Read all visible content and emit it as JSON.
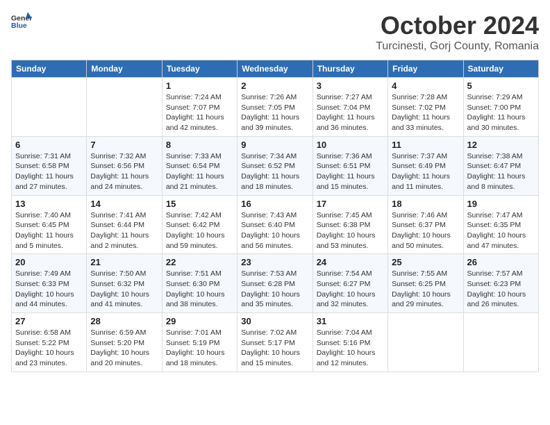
{
  "header": {
    "logo_general": "General",
    "logo_blue": "Blue",
    "month": "October 2024",
    "location": "Turcinesti, Gorj County, Romania"
  },
  "weekdays": [
    "Sunday",
    "Monday",
    "Tuesday",
    "Wednesday",
    "Thursday",
    "Friday",
    "Saturday"
  ],
  "weeks": [
    [
      {
        "day": "",
        "sunrise": "",
        "sunset": "",
        "daylight": ""
      },
      {
        "day": "",
        "sunrise": "",
        "sunset": "",
        "daylight": ""
      },
      {
        "day": "1",
        "sunrise": "Sunrise: 7:24 AM",
        "sunset": "Sunset: 7:07 PM",
        "daylight": "Daylight: 11 hours and 42 minutes."
      },
      {
        "day": "2",
        "sunrise": "Sunrise: 7:26 AM",
        "sunset": "Sunset: 7:05 PM",
        "daylight": "Daylight: 11 hours and 39 minutes."
      },
      {
        "day": "3",
        "sunrise": "Sunrise: 7:27 AM",
        "sunset": "Sunset: 7:04 PM",
        "daylight": "Daylight: 11 hours and 36 minutes."
      },
      {
        "day": "4",
        "sunrise": "Sunrise: 7:28 AM",
        "sunset": "Sunset: 7:02 PM",
        "daylight": "Daylight: 11 hours and 33 minutes."
      },
      {
        "day": "5",
        "sunrise": "Sunrise: 7:29 AM",
        "sunset": "Sunset: 7:00 PM",
        "daylight": "Daylight: 11 hours and 30 minutes."
      }
    ],
    [
      {
        "day": "6",
        "sunrise": "Sunrise: 7:31 AM",
        "sunset": "Sunset: 6:58 PM",
        "daylight": "Daylight: 11 hours and 27 minutes."
      },
      {
        "day": "7",
        "sunrise": "Sunrise: 7:32 AM",
        "sunset": "Sunset: 6:56 PM",
        "daylight": "Daylight: 11 hours and 24 minutes."
      },
      {
        "day": "8",
        "sunrise": "Sunrise: 7:33 AM",
        "sunset": "Sunset: 6:54 PM",
        "daylight": "Daylight: 11 hours and 21 minutes."
      },
      {
        "day": "9",
        "sunrise": "Sunrise: 7:34 AM",
        "sunset": "Sunset: 6:52 PM",
        "daylight": "Daylight: 11 hours and 18 minutes."
      },
      {
        "day": "10",
        "sunrise": "Sunrise: 7:36 AM",
        "sunset": "Sunset: 6:51 PM",
        "daylight": "Daylight: 11 hours and 15 minutes."
      },
      {
        "day": "11",
        "sunrise": "Sunrise: 7:37 AM",
        "sunset": "Sunset: 6:49 PM",
        "daylight": "Daylight: 11 hours and 11 minutes."
      },
      {
        "day": "12",
        "sunrise": "Sunrise: 7:38 AM",
        "sunset": "Sunset: 6:47 PM",
        "daylight": "Daylight: 11 hours and 8 minutes."
      }
    ],
    [
      {
        "day": "13",
        "sunrise": "Sunrise: 7:40 AM",
        "sunset": "Sunset: 6:45 PM",
        "daylight": "Daylight: 11 hours and 5 minutes."
      },
      {
        "day": "14",
        "sunrise": "Sunrise: 7:41 AM",
        "sunset": "Sunset: 6:44 PM",
        "daylight": "Daylight: 11 hours and 2 minutes."
      },
      {
        "day": "15",
        "sunrise": "Sunrise: 7:42 AM",
        "sunset": "Sunset: 6:42 PM",
        "daylight": "Daylight: 10 hours and 59 minutes."
      },
      {
        "day": "16",
        "sunrise": "Sunrise: 7:43 AM",
        "sunset": "Sunset: 6:40 PM",
        "daylight": "Daylight: 10 hours and 56 minutes."
      },
      {
        "day": "17",
        "sunrise": "Sunrise: 7:45 AM",
        "sunset": "Sunset: 6:38 PM",
        "daylight": "Daylight: 10 hours and 53 minutes."
      },
      {
        "day": "18",
        "sunrise": "Sunrise: 7:46 AM",
        "sunset": "Sunset: 6:37 PM",
        "daylight": "Daylight: 10 hours and 50 minutes."
      },
      {
        "day": "19",
        "sunrise": "Sunrise: 7:47 AM",
        "sunset": "Sunset: 6:35 PM",
        "daylight": "Daylight: 10 hours and 47 minutes."
      }
    ],
    [
      {
        "day": "20",
        "sunrise": "Sunrise: 7:49 AM",
        "sunset": "Sunset: 6:33 PM",
        "daylight": "Daylight: 10 hours and 44 minutes."
      },
      {
        "day": "21",
        "sunrise": "Sunrise: 7:50 AM",
        "sunset": "Sunset: 6:32 PM",
        "daylight": "Daylight: 10 hours and 41 minutes."
      },
      {
        "day": "22",
        "sunrise": "Sunrise: 7:51 AM",
        "sunset": "Sunset: 6:30 PM",
        "daylight": "Daylight: 10 hours and 38 minutes."
      },
      {
        "day": "23",
        "sunrise": "Sunrise: 7:53 AM",
        "sunset": "Sunset: 6:28 PM",
        "daylight": "Daylight: 10 hours and 35 minutes."
      },
      {
        "day": "24",
        "sunrise": "Sunrise: 7:54 AM",
        "sunset": "Sunset: 6:27 PM",
        "daylight": "Daylight: 10 hours and 32 minutes."
      },
      {
        "day": "25",
        "sunrise": "Sunrise: 7:55 AM",
        "sunset": "Sunset: 6:25 PM",
        "daylight": "Daylight: 10 hours and 29 minutes."
      },
      {
        "day": "26",
        "sunrise": "Sunrise: 7:57 AM",
        "sunset": "Sunset: 6:23 PM",
        "daylight": "Daylight: 10 hours and 26 minutes."
      }
    ],
    [
      {
        "day": "27",
        "sunrise": "Sunrise: 6:58 AM",
        "sunset": "Sunset: 5:22 PM",
        "daylight": "Daylight: 10 hours and 23 minutes."
      },
      {
        "day": "28",
        "sunrise": "Sunrise: 6:59 AM",
        "sunset": "Sunset: 5:20 PM",
        "daylight": "Daylight: 10 hours and 20 minutes."
      },
      {
        "day": "29",
        "sunrise": "Sunrise: 7:01 AM",
        "sunset": "Sunset: 5:19 PM",
        "daylight": "Daylight: 10 hours and 18 minutes."
      },
      {
        "day": "30",
        "sunrise": "Sunrise: 7:02 AM",
        "sunset": "Sunset: 5:17 PM",
        "daylight": "Daylight: 10 hours and 15 minutes."
      },
      {
        "day": "31",
        "sunrise": "Sunrise: 7:04 AM",
        "sunset": "Sunset: 5:16 PM",
        "daylight": "Daylight: 10 hours and 12 minutes."
      },
      {
        "day": "",
        "sunrise": "",
        "sunset": "",
        "daylight": ""
      },
      {
        "day": "",
        "sunrise": "",
        "sunset": "",
        "daylight": ""
      }
    ]
  ]
}
